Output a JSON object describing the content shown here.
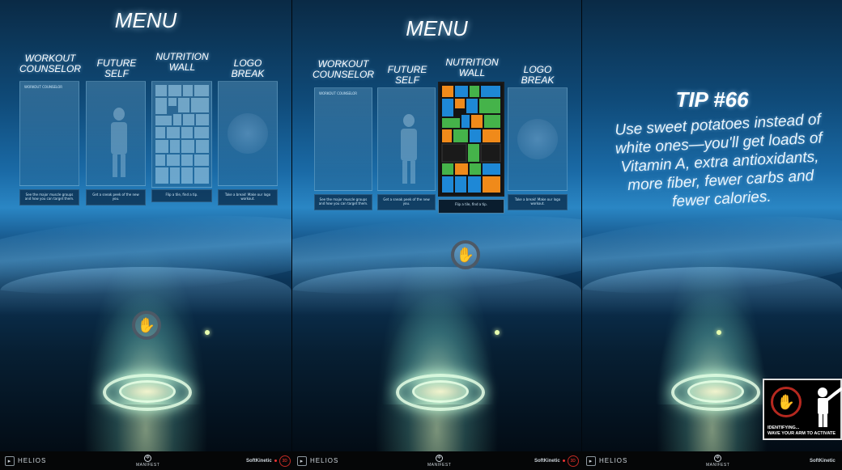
{
  "screens": [
    {
      "menu_title": "MENU",
      "options": [
        {
          "label_line1": "WORKOUT",
          "label_line2": "COUNSELOR",
          "caption": "See the major muscle groups and how you can target them."
        },
        {
          "label_line1": "FUTURE SELF",
          "label_line2": "",
          "caption": "Get a sneak peek of the new you."
        },
        {
          "label_line1": "NUTRITION",
          "label_line2": "WALL",
          "caption": "Flip a tile, find a tip."
        },
        {
          "label_line1": "LOGO BREAK",
          "label_line2": "",
          "caption": "Take a break! Make our logo workout."
        }
      ],
      "panel_header": "WORKOUT COUNSELOR"
    },
    {
      "menu_title": "MENU",
      "options": [
        {
          "label_line1": "WORKOUT",
          "label_line2": "COUNSELOR",
          "caption": "See the major muscle groups and how you can target them."
        },
        {
          "label_line1": "FUTURE SELF",
          "label_line2": "",
          "caption": "Get a sneak peek of the new you."
        },
        {
          "label_line1": "NUTRITION",
          "label_line2": "WALL",
          "caption": "Flip a tile, find a tip."
        },
        {
          "label_line1": "LOGO BREAK",
          "label_line2": "",
          "caption": "Take a break! Make our logo workout."
        }
      ],
      "panel_header": "WORKOUT COUNSELOR",
      "active_option": "NUTRITION WALL"
    },
    {
      "tip_title": "TIP #66",
      "tip_body": "Use sweet potatoes instead of white ones—you'll get loads of Vitamin A, extra antioxidants, more fiber, fewer carbs and fewer calories."
    }
  ],
  "identify_overlay": {
    "line1": "IDENTIFYING...",
    "line2": "WAVE YOUR ARM TO ACTIVATE"
  },
  "bottom_bar": {
    "helios": "HELIOS",
    "manifest": "MANIFEST",
    "softkinetic": "SoftKinetic",
    "badge": "3D"
  },
  "icons": {
    "hand": "hand-icon",
    "helios": "helios-icon",
    "manifest": "gear-icon"
  },
  "colors": {
    "tile_blue": "#1e88d6",
    "tile_green": "#45b34a",
    "tile_orange": "#f08a1a",
    "tile_dark": "#1a1a1a",
    "cursor_ring": "#4d5966",
    "brand_red": "#c02a24"
  }
}
